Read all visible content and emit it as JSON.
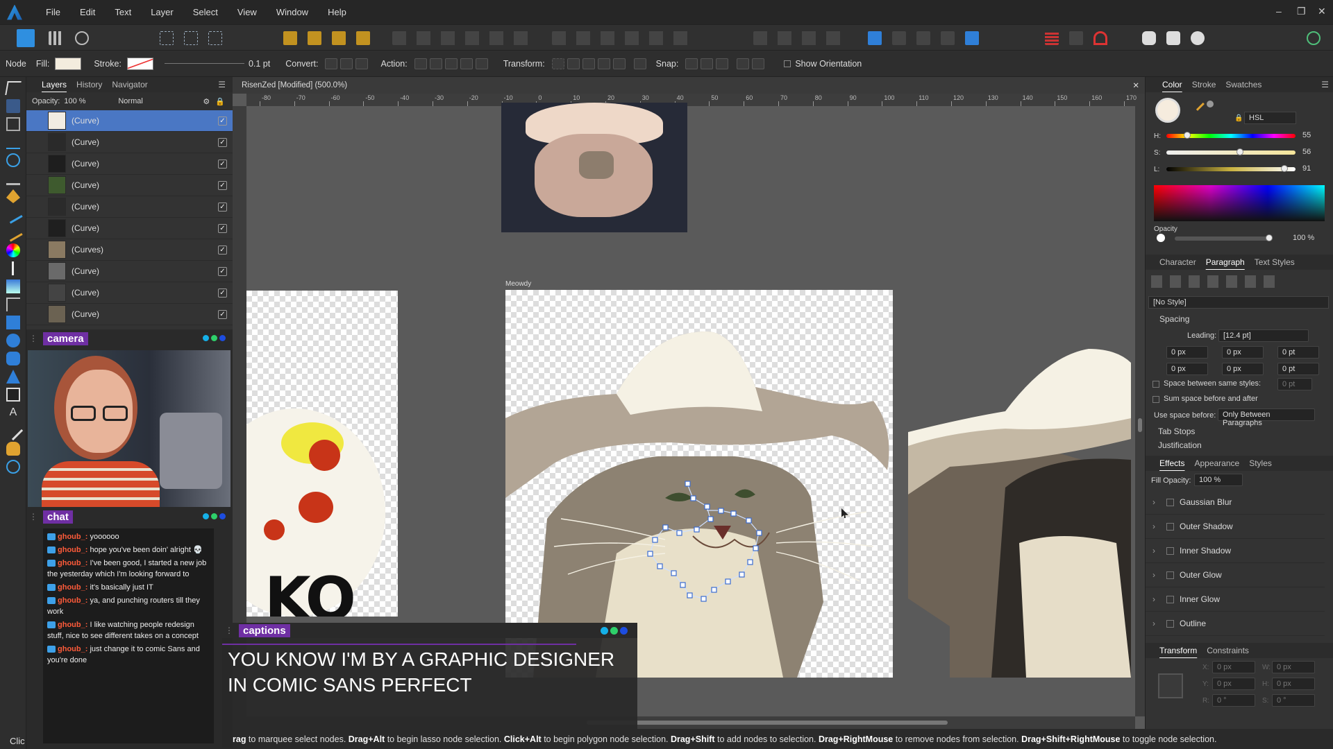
{
  "menubar": {
    "items": [
      "File",
      "Edit",
      "Text",
      "Layer",
      "Select",
      "View",
      "Window",
      "Help"
    ]
  },
  "context": {
    "mode": "Node",
    "fill_label": "Fill:",
    "stroke_label": "Stroke:",
    "stroke_width": "0.1 pt",
    "convert_label": "Convert:",
    "action_label": "Action:",
    "transform_label": "Transform:",
    "snap_label": "Snap:",
    "orientation_label": "Show Orientation"
  },
  "layers": {
    "tabs": [
      "Layers",
      "History",
      "Navigator"
    ],
    "opacity_label": "Opacity:",
    "opacity": "100 %",
    "blend": "Normal",
    "items": [
      "(Curve)",
      "(Curve)",
      "(Curve)",
      "(Curve)",
      "(Curve)",
      "(Curve)",
      "(Curves)",
      "(Curve)",
      "(Curve)",
      "(Curve)"
    ]
  },
  "camera": {
    "label": "camera"
  },
  "chat": {
    "label": "chat",
    "messages": [
      {
        "user": "ghoub_:",
        "text": "yoooooo"
      },
      {
        "user": "ghoub_:",
        "text": "hope you've been doin' alright 💀"
      },
      {
        "user": "ghoub_:",
        "text": "I've been good, I started a new job the yesterday which I'm looking forward to"
      },
      {
        "user": "ghoub_:",
        "text": "it's basically just IT"
      },
      {
        "user": "ghoub_:",
        "text": "ya, and punching routers till they work"
      },
      {
        "user": "ghoub_:",
        "text": "I like watching people redesign stuff, nice to see different takes on a concept"
      },
      {
        "user": "ghoub_:",
        "text": "just change it to comic Sans and you're done"
      }
    ]
  },
  "doc": {
    "title": "RisenZed [Modified] (500.0%)",
    "artboard_label": "Meowdy",
    "ruler": [
      "-80",
      "-70",
      "-60",
      "-50",
      "-40",
      "-30",
      "-20",
      "-10",
      "0",
      "10",
      "20",
      "30",
      "40",
      "50",
      "60",
      "70",
      "80",
      "90",
      "100",
      "110",
      "120",
      "130",
      "140",
      "150",
      "160",
      "170"
    ]
  },
  "captions": {
    "label": "captions",
    "text": "YOU KNOW I'M BY A GRAPHIC DESIGNER IN COMIC SANS PERFECT"
  },
  "color": {
    "tabs": [
      "Color",
      "Stroke",
      "Swatches"
    ],
    "model": "HSL",
    "h_label": "H:",
    "h": "55",
    "s_label": "S:",
    "s": "56",
    "l_label": "L:",
    "l": "91",
    "opacity_label": "Opacity",
    "opacity": "100 %"
  },
  "paragraph": {
    "tabs": [
      "Character",
      "Paragraph",
      "Text Styles"
    ],
    "style": "[No Style]",
    "spacing_label": "Spacing",
    "leading_label": "Leading:",
    "leading": "[12.4 pt]",
    "fields": [
      "0 px",
      "0 px",
      "0 pt",
      "0 px",
      "0 px",
      "0 pt"
    ],
    "same_styles": "Space between same styles:",
    "same_styles_val": "0 pt",
    "sum_space": "Sum space before and after",
    "use_space_label": "Use space before:",
    "use_space": "Only Between Paragraphs",
    "tab_stops": "Tab Stops",
    "justification": "Justification"
  },
  "effects": {
    "tabs": [
      "Effects",
      "Appearance",
      "Styles"
    ],
    "fill_opacity_label": "Fill Opacity:",
    "fill_opacity": "100 %",
    "items": [
      "Gaussian Blur",
      "Outer Shadow",
      "Inner Shadow",
      "Outer Glow",
      "Inner Glow",
      "Outline"
    ]
  },
  "transform": {
    "tabs": [
      "Transform",
      "Constraints"
    ],
    "fields": [
      "0 px",
      "0 px",
      "0 px",
      "0 px",
      "0 °",
      "0 °"
    ],
    "labels": [
      "X:",
      "W:",
      "Y:",
      "H:",
      "R:",
      "S:"
    ]
  },
  "status": {
    "p1": "rag",
    "t1": " to marquee select nodes. ",
    "p2": "Drag+Alt",
    "t2": " to begin lasso node selection. ",
    "p3": "Click+Alt",
    "t3": " to begin polygon node selection. ",
    "p4": "Drag+Shift",
    "t4": " to add nodes to selection. ",
    "p5": "Drag+RightMouse",
    "t5": " to remove nodes from selection. ",
    "p6": "Drag+Shift+RightMouse",
    "t6": " to toggle node selection.",
    "left": "Clic"
  },
  "colors": {
    "accent": "#4a77c4",
    "selection_blue": "#4a77c4",
    "twitch_purple": "#6f2fa3",
    "chat_user": "#ff5b3a"
  }
}
